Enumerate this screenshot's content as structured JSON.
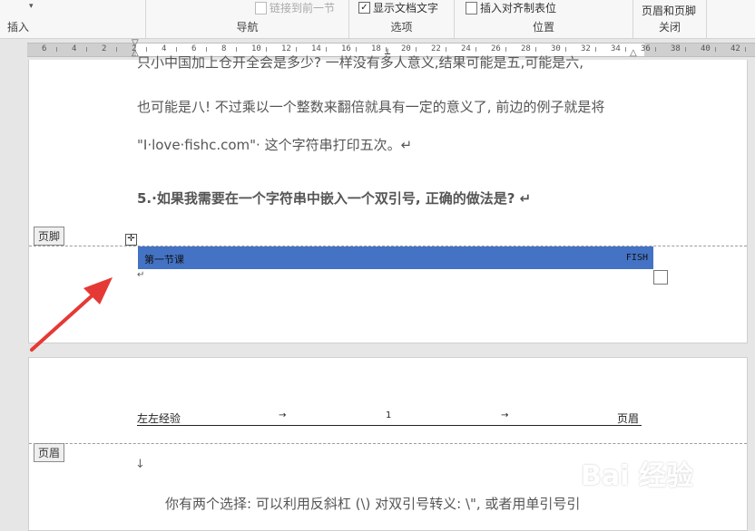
{
  "ribbon": {
    "insert_label": "插入",
    "nav_group_label": "导航",
    "link_prev_label": "链接到前一节",
    "options_group_label": "选项",
    "show_doc_text_label": "显示文档文字",
    "position_group_label": "位置",
    "insert_align_tab_label": "插入对齐制表位",
    "header_footer_label": "页眉和页脚",
    "close_group_label": "关闭"
  },
  "ruler": {
    "numbers": [
      "6",
      "4",
      "2",
      "2",
      "4",
      "6",
      "8",
      "10",
      "12",
      "14",
      "16",
      "18",
      "20",
      "22",
      "24",
      "26",
      "28",
      "30",
      "32",
      "34",
      "36",
      "38",
      "40",
      "42"
    ]
  },
  "page1": {
    "lines": [
      "只小中国加上仓开全会是多少?  一样没有多人意义,结果可能是五,可能是六,",
      "也可能是八! 不过乘以一个整数来翻倍就具有一定的意义了, 前边的例子就是将",
      "\"I·love·fishc.com\"· 这个字符串打印五次。↵",
      "5.·如果我需要在一个字符串中嵌入一个双引号, 正确的做法是? ↵"
    ],
    "footer_tag": "页脚",
    "footer_left_text": "第一节课",
    "footer_right_text": "FISH"
  },
  "page2": {
    "header_left": "左左经验",
    "tab_arrow": "→",
    "header_center": "1",
    "header_right": "页眉",
    "header_tag": "页眉",
    "body_line": "你有两个选择: 可以利用反斜杠 (\\) 对双引号转义: \\\", 或者用单引号引"
  },
  "watermark": {
    "text": "Bai 经验"
  },
  "colors": {
    "footer_band": "#4472c4",
    "arrow": "#e53935"
  }
}
